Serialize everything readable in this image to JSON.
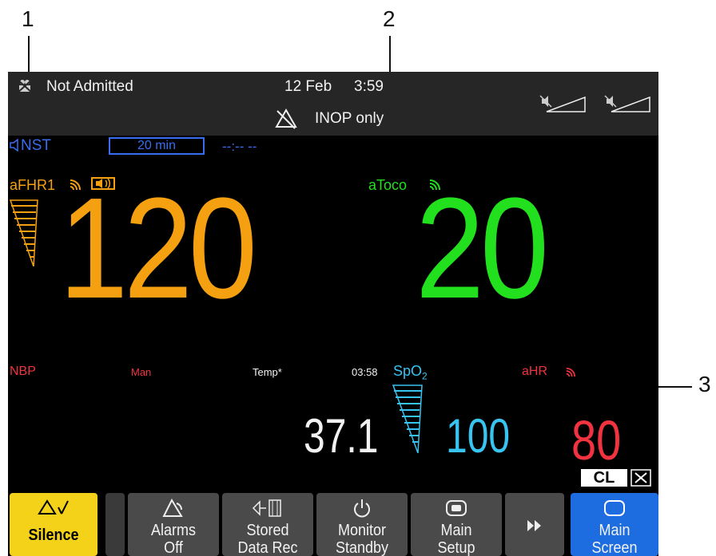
{
  "callouts": {
    "c1": "1",
    "c2": "2",
    "c3": "3"
  },
  "header": {
    "patient_status": "Not Admitted",
    "date": "12 Feb",
    "time": "3:59",
    "alarm_status": "INOP only"
  },
  "nst": {
    "label": "NST",
    "timer": "20 min",
    "clock": "--:-- --"
  },
  "fhr": {
    "label": "aFHR1",
    "value": "120"
  },
  "toco": {
    "label": "aToco",
    "value": "20"
  },
  "lower": {
    "nbp_label": "NBP",
    "nbp_mode": "Man",
    "temp_label": "Temp*",
    "time": "03:58",
    "spo2_label": "SpO",
    "spo2_sub": "2",
    "hr_label": "aHR",
    "temp_value": "37.1",
    "spo2_value": "100",
    "hr_value": "80"
  },
  "small_buttons": {
    "cl": "CL"
  },
  "softkeys": {
    "silence": "Silence",
    "alarms_off_1": "Alarms",
    "alarms_off_2": "Off",
    "stored_1": "Stored",
    "stored_2": "Data Rec",
    "monitor_1": "Monitor",
    "monitor_2": "Standby",
    "setup_1": "Main",
    "setup_2": "Setup",
    "main_screen_1": "Main",
    "main_screen_2": "Screen"
  },
  "colors": {
    "fhr": "#f5a010",
    "toco": "#22e01e",
    "spo2": "#38c4f0",
    "hr": "#f0333f",
    "nst": "#3a6cf0",
    "silence_key": "#f5d21a",
    "main_screen_key": "#1e6de0"
  }
}
